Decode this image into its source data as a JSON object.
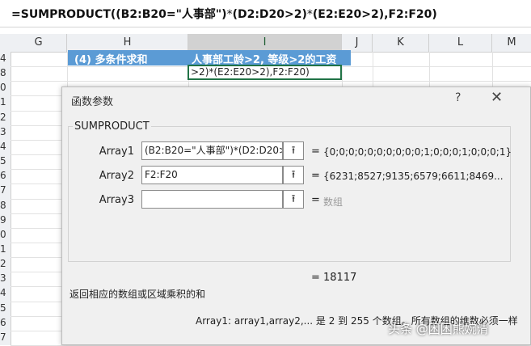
{
  "formula_bar": {
    "prefix": "=SUMPRODUCT(",
    "arg1_bold": "(B2:B20=\"人事部\")",
    "mult1": "*",
    "arg2_bold": "(D2:D20>2)",
    "mult2": "*",
    "arg3_bold": "(E2:E20>2)",
    "tail": ",F2:F20)"
  },
  "columns": [
    "G",
    "H",
    "I",
    "J",
    "K",
    "L",
    "M"
  ],
  "rows": [
    "4",
    "8",
    "0",
    "1",
    "2",
    "3",
    "4",
    "5",
    "6",
    "7",
    "8",
    "9",
    "0",
    "1",
    "2",
    "3",
    "4",
    "5",
    "6",
    "7"
  ],
  "sheet": {
    "banner_h": "(4) 多条件求和",
    "banner_i": "人事部工龄>2, 等级>2的工资",
    "editing_cell": ">2)*(E2:E20>2),F2:F20)"
  },
  "dialog": {
    "title": "函数参数",
    "help": "?",
    "close": "✕",
    "function_name": "SUMPRODUCT",
    "args": [
      {
        "label": "Array1",
        "value": "(B2:B20=\"人事部\")*(D2:D20>2",
        "result": "{0;0;0;0;0;0;0;0;0;0;1;0;0;0;1;0;0;0;1}"
      },
      {
        "label": "Array2",
        "value": "F2:F20",
        "result": "{6231;8527;9135;6579;6611;8469..."
      },
      {
        "label": "Array3",
        "value": "",
        "result": "数组"
      }
    ],
    "equals": "=",
    "result_value": "18117",
    "description": "返回相应的数组或区域乘积的和",
    "arg_description": "Array1:  array1,array2,... 是 2 到 255 个数组。所有数组的维数必须一样"
  },
  "watermark": "头条 @困困熊婉清"
}
